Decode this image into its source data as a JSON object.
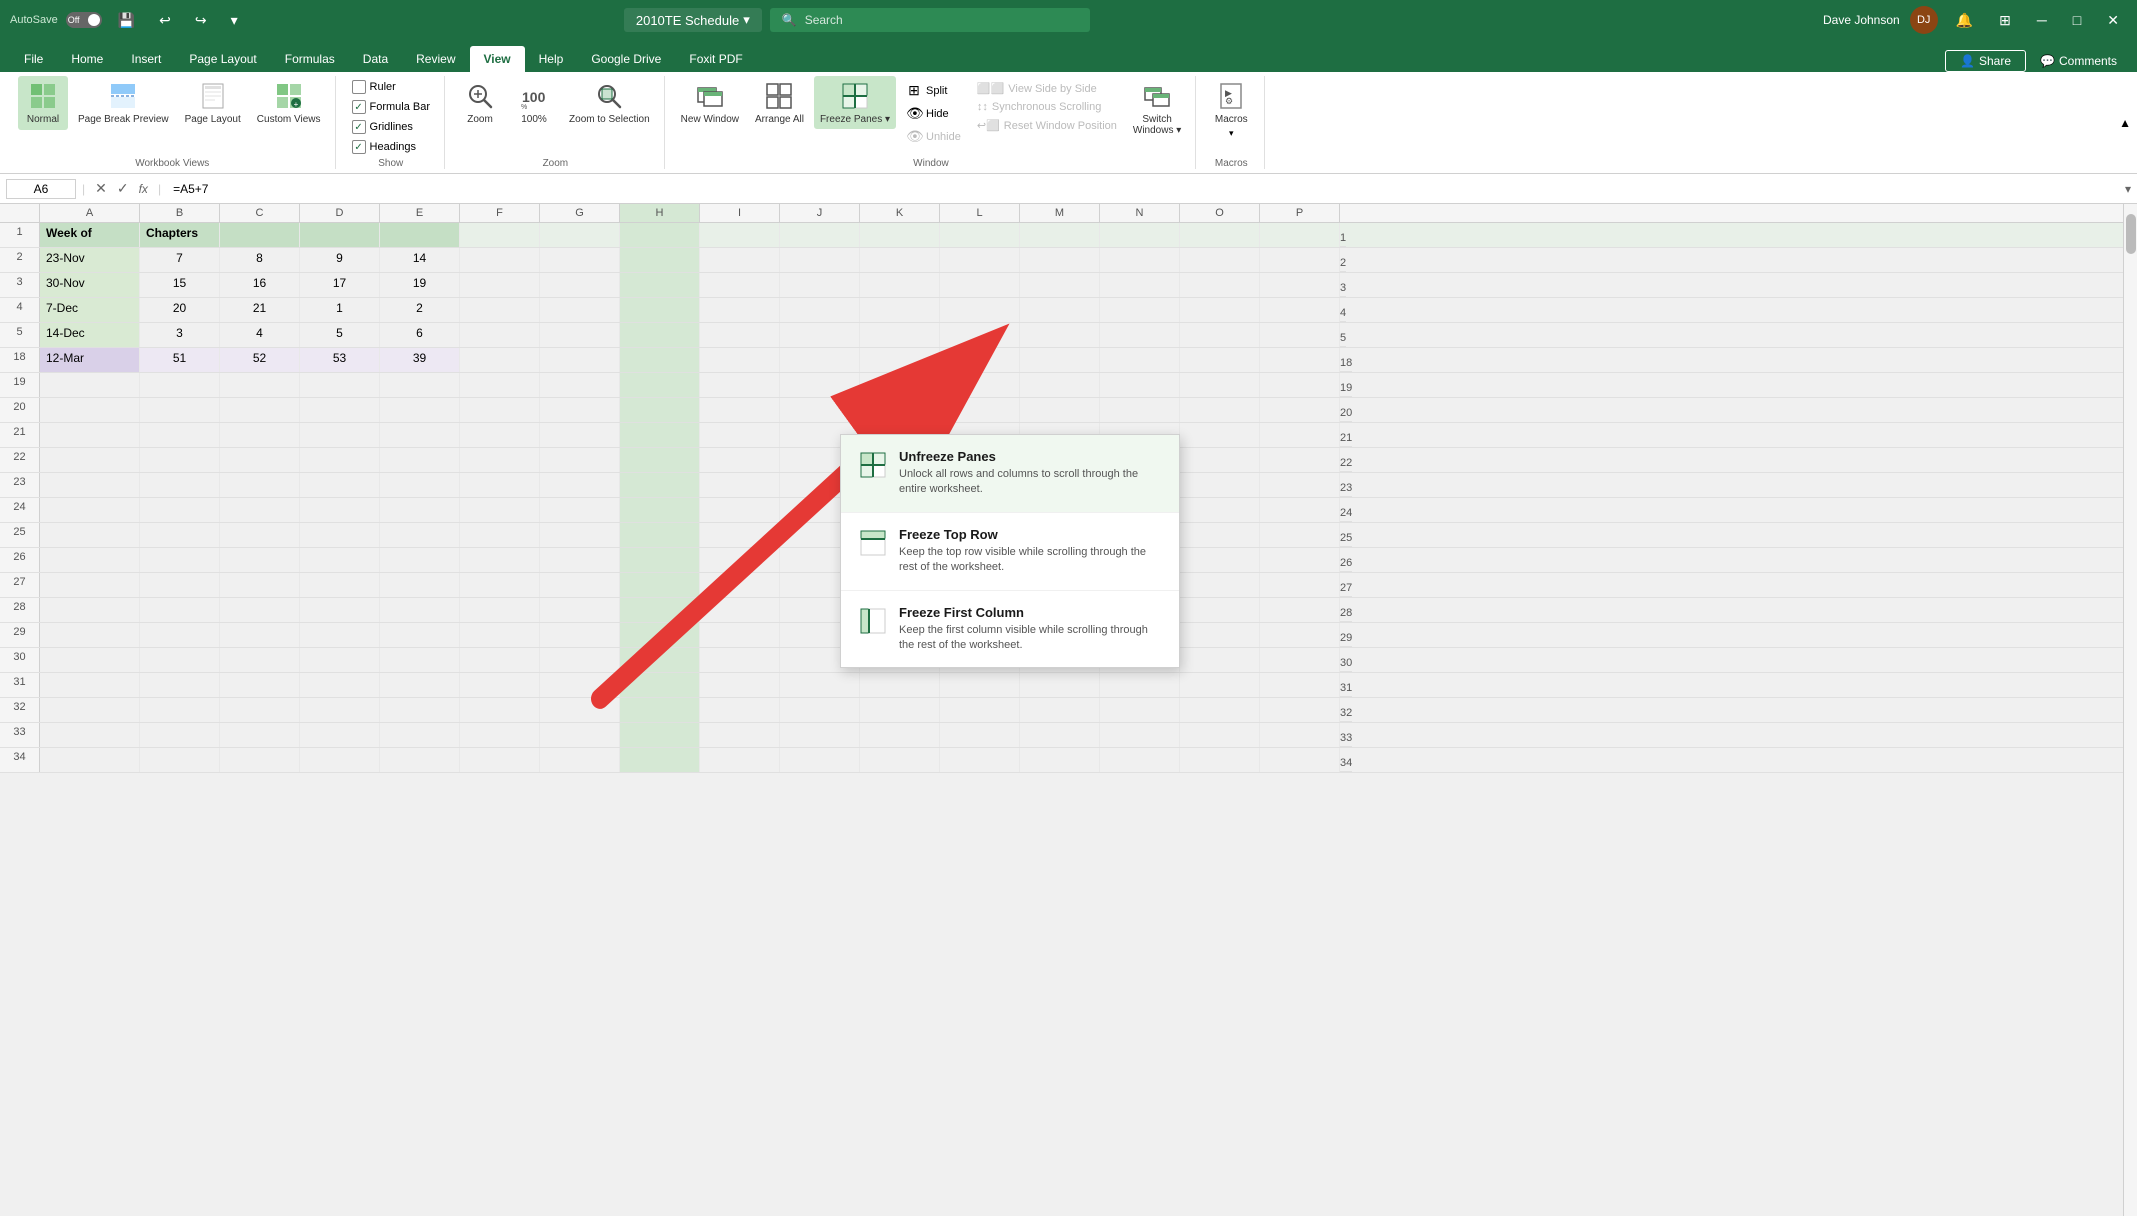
{
  "titleBar": {
    "autosave_label": "AutoSave",
    "autosave_off": "Off",
    "filename": "2010TE Schedule",
    "search_placeholder": "Search",
    "user_name": "Dave Johnson",
    "minimize": "─",
    "maximize": "□",
    "close": "✕"
  },
  "ribbonTabs": {
    "tabs": [
      {
        "id": "file",
        "label": "File"
      },
      {
        "id": "home",
        "label": "Home"
      },
      {
        "id": "insert",
        "label": "Insert"
      },
      {
        "id": "pagelayout",
        "label": "Page Layout"
      },
      {
        "id": "formulas",
        "label": "Formulas"
      },
      {
        "id": "data",
        "label": "Data"
      },
      {
        "id": "review",
        "label": "Review"
      },
      {
        "id": "view",
        "label": "View",
        "active": true
      },
      {
        "id": "help",
        "label": "Help"
      },
      {
        "id": "googledrive",
        "label": "Google Drive"
      },
      {
        "id": "foxitpdf",
        "label": "Foxit PDF"
      }
    ],
    "share_label": "Share",
    "comments_label": "Comments"
  },
  "ribbon": {
    "workbookViews": {
      "label": "Workbook Views",
      "normal": "Normal",
      "pageBreakPreview": "Page Break Preview",
      "pageLayout": "Page Layout",
      "customViews": "Custom Views"
    },
    "show": {
      "label": "Show",
      "ruler": "Ruler",
      "formulaBar": "Formula Bar",
      "gridlines": "Gridlines",
      "headings": "Headings",
      "ruler_checked": false,
      "formulaBar_checked": true,
      "gridlines_checked": true,
      "headings_checked": true
    },
    "zoom": {
      "label": "Zoom",
      "zoom": "Zoom",
      "zoom100": "100%",
      "zoomToSelection": "Zoom to Selection"
    },
    "window": {
      "label": "Window",
      "newWindow": "New Window",
      "arrangeAll": "Arrange All",
      "freezePanes": "Freeze Panes",
      "split": "Split",
      "hide": "Hide",
      "unhide": "Unhide",
      "viewSideBySide": "View Side by Side",
      "synchronousScrolling": "Synchronous Scrolling",
      "resetWindowPosition": "Reset Window Position",
      "switchWindows": "Switch Windows"
    },
    "macros": {
      "label": "Macros",
      "macros": "Macros"
    }
  },
  "formulaBar": {
    "cellRef": "A6",
    "formula": "=A5+7"
  },
  "columns": [
    "A",
    "B",
    "C",
    "D",
    "E",
    "F",
    "G",
    "H",
    "I",
    "J",
    "K",
    "L",
    "M",
    "N",
    "O",
    "P"
  ],
  "frozenRows": [
    {
      "row": 1,
      "cells": [
        "Week of",
        "Chapters",
        "",
        "",
        "",
        "",
        "",
        ""
      ]
    }
  ],
  "dataRows": [
    {
      "row": 2,
      "cells": [
        "23-Nov",
        "7",
        "8",
        "9",
        "14",
        "",
        "",
        ""
      ],
      "type": "normal"
    },
    {
      "row": 3,
      "cells": [
        "30-Nov",
        "15",
        "16",
        "17",
        "19",
        "",
        "",
        ""
      ],
      "type": "normal"
    },
    {
      "row": 4,
      "cells": [
        "7-Dec",
        "20",
        "21",
        "1",
        "2",
        "",
        "",
        ""
      ],
      "type": "normal"
    },
    {
      "row": 5,
      "cells": [
        "14-Dec",
        "3",
        "4",
        "5",
        "6",
        "",
        "",
        ""
      ],
      "type": "normal"
    },
    {
      "row": 18,
      "cells": [
        "12-Mar",
        "51",
        "52",
        "53",
        "39",
        "",
        "",
        ""
      ],
      "type": "purple"
    },
    {
      "row": 19,
      "cells": [
        "",
        "",
        "",
        "",
        "",
        "",
        "",
        ""
      ],
      "type": "empty"
    },
    {
      "row": 20,
      "cells": [
        "",
        "",
        "",
        "",
        "",
        "",
        "",
        ""
      ],
      "type": "empty"
    },
    {
      "row": 21,
      "cells": [
        "",
        "",
        "",
        "",
        "",
        "",
        "",
        ""
      ],
      "type": "empty"
    },
    {
      "row": 22,
      "cells": [
        "",
        "",
        "",
        "",
        "",
        "",
        "",
        ""
      ],
      "type": "empty"
    },
    {
      "row": 23,
      "cells": [
        "",
        "",
        "",
        "",
        "",
        "",
        "",
        ""
      ],
      "type": "empty"
    },
    {
      "row": 24,
      "cells": [
        "",
        "",
        "",
        "",
        "",
        "",
        "",
        ""
      ],
      "type": "empty"
    },
    {
      "row": 25,
      "cells": [
        "",
        "",
        "",
        "",
        "",
        "",
        "",
        ""
      ],
      "type": "empty"
    },
    {
      "row": 26,
      "cells": [
        "",
        "",
        "",
        "",
        "",
        "",
        "",
        ""
      ],
      "type": "empty"
    },
    {
      "row": 27,
      "cells": [
        "",
        "",
        "",
        "",
        "",
        "",
        "",
        ""
      ],
      "type": "empty"
    },
    {
      "row": 28,
      "cells": [
        "",
        "",
        "",
        "",
        "",
        "",
        "",
        ""
      ],
      "type": "empty"
    },
    {
      "row": 29,
      "cells": [
        "",
        "",
        "",
        "",
        "",
        "",
        "",
        ""
      ],
      "type": "empty"
    },
    {
      "row": 30,
      "cells": [
        "",
        "",
        "",
        "",
        "",
        "",
        "",
        ""
      ],
      "type": "empty"
    },
    {
      "row": 31,
      "cells": [
        "",
        "",
        "",
        "",
        "",
        "",
        "",
        ""
      ],
      "type": "empty"
    },
    {
      "row": 32,
      "cells": [
        "",
        "",
        "",
        "",
        "",
        "",
        "",
        ""
      ],
      "type": "empty"
    },
    {
      "row": 33,
      "cells": [
        "",
        "",
        "",
        "",
        "",
        "",
        "",
        ""
      ],
      "type": "empty"
    },
    {
      "row": 34,
      "cells": [
        "",
        "",
        "",
        "",
        "",
        "",
        "",
        ""
      ],
      "type": "empty"
    }
  ],
  "freezeDropdown": {
    "items": [
      {
        "id": "unfreeze",
        "title": "Unfreeze Panes",
        "description": "Unlock all rows and columns to scroll through the entire worksheet.",
        "active": true
      },
      {
        "id": "freeze-top",
        "title": "Freeze Top Row",
        "description": "Keep the top row visible while scrolling through the rest of the worksheet.",
        "active": false
      },
      {
        "id": "freeze-first-col",
        "title": "Freeze First Column",
        "description": "Keep the first column visible while scrolling through the rest of the worksheet.",
        "active": false
      }
    ]
  },
  "colors": {
    "excel_green": "#1e6e42",
    "freeze_highlight": "#c8e6c9",
    "row_header_bg": "#e8f0e8",
    "purple_cell": "#e8d5e8",
    "selected_blue": "#4a8fd4"
  }
}
